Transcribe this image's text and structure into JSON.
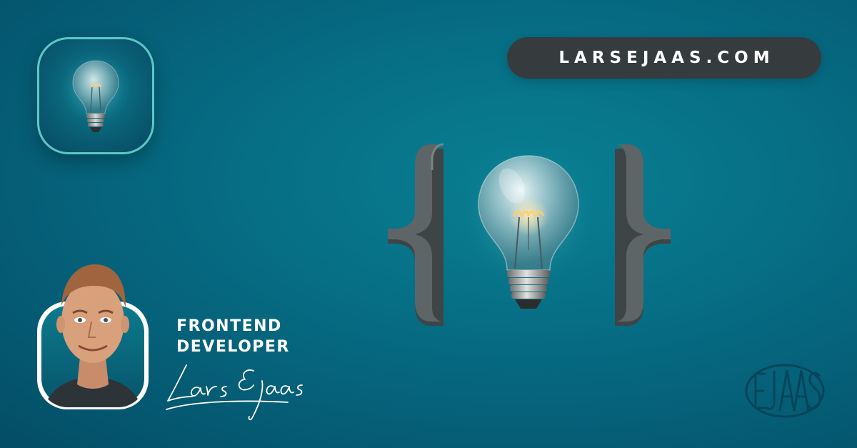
{
  "brand": {
    "url": "LARSEJAAS.COM",
    "monogram": "EJAAS"
  },
  "profile": {
    "title_line1": "FRONTEND",
    "title_line2": "DEVELOPER",
    "signature": "Lars Ejaas"
  },
  "icons": {
    "app_icon": "lightbulb-icon",
    "hero": "curly-braces-lightbulb-icon"
  },
  "colors": {
    "background": "#066e85",
    "pill": "#363c3e",
    "accent_border": "#5cc7c8",
    "brace": "#5d6566",
    "text": "#ffffff"
  }
}
